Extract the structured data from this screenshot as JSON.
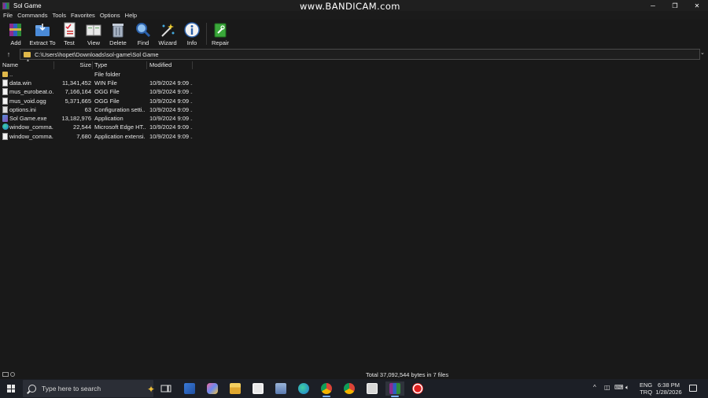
{
  "window": {
    "title": "Sol Game",
    "watermark": "www.BANDICAM.com",
    "controls": {
      "minimize": "─",
      "restore": "❐",
      "close": "✕"
    }
  },
  "menu": [
    "File",
    "Commands",
    "Tools",
    "Favorites",
    "Options",
    "Help"
  ],
  "toolbar": {
    "buttons": [
      {
        "label": "Add",
        "icon": "add-archive-icon"
      },
      {
        "label": "Extract To",
        "icon": "extract-folder-icon"
      },
      {
        "label": "Test",
        "icon": "test-checklist-icon"
      },
      {
        "label": "View",
        "icon": "view-book-icon"
      },
      {
        "label": "Delete",
        "icon": "trash-icon"
      },
      {
        "label": "Find",
        "icon": "magnifier-icon"
      },
      {
        "label": "Wizard",
        "icon": "wand-icon"
      },
      {
        "label": "Info",
        "icon": "info-icon"
      },
      {
        "label": "Repair",
        "icon": "repair-kit-icon"
      }
    ]
  },
  "address": {
    "up": "↑",
    "path": "C:\\Users\\hopet\\Downloads\\sol-game\\Sol Game",
    "dropdown": "⌄"
  },
  "columns": {
    "name": "Name",
    "size": "Size",
    "type": "Type",
    "modified": "Modified"
  },
  "files": [
    {
      "name": "..",
      "size": "",
      "type": "File folder",
      "modified": "",
      "icon": "folder-icon"
    },
    {
      "name": "data.win",
      "size": "11,341,452",
      "type": "WIN File",
      "modified": "10/9/2024 9:09 ...",
      "icon": "file-icon"
    },
    {
      "name": "mus_eurobeat.o...",
      "size": "7,166,164",
      "type": "OGG File",
      "modified": "10/9/2024 9:09 ...",
      "icon": "audio-file-icon"
    },
    {
      "name": "mus_void.ogg",
      "size": "5,371,665",
      "type": "OGG File",
      "modified": "10/9/2024 9:09 ...",
      "icon": "audio-file-icon"
    },
    {
      "name": "options.ini",
      "size": "63",
      "type": "Configuration setti...",
      "modified": "10/9/2024 9:09 ...",
      "icon": "settings-file-icon"
    },
    {
      "name": "Sol Game.exe",
      "size": "13,182,976",
      "type": "Application",
      "modified": "10/9/2024 9:09 ...",
      "icon": "app-exe-icon"
    },
    {
      "name": "window_comma...",
      "size": "22,544",
      "type": "Microsoft Edge HT...",
      "modified": "10/9/2024 9:09 ...",
      "icon": "edge-file-icon"
    },
    {
      "name": "window_comma...",
      "size": "7,680",
      "type": "Application extensi...",
      "modified": "10/9/2024 9:09 ...",
      "icon": "dll-file-icon"
    }
  ],
  "status": {
    "text": "Total 37,092,544 bytes in 7 files"
  },
  "taskbar": {
    "search_placeholder": "Type here to search",
    "apps": [
      "task-view-icon",
      "mail-icon",
      "copilot-icon",
      "file-explorer-icon",
      "store-icon",
      "remote-desktop-icon",
      "edge-icon",
      "chrome-icon",
      "chrome-profile-icon",
      "file-manager-icon",
      "winrar-icon",
      "bandicam-record-icon"
    ],
    "tray": {
      "chevron": "^",
      "lang_top": "ENG",
      "lang_bottom": "TRQ",
      "time": "6:38 PM",
      "date": "1/28/2026"
    }
  }
}
